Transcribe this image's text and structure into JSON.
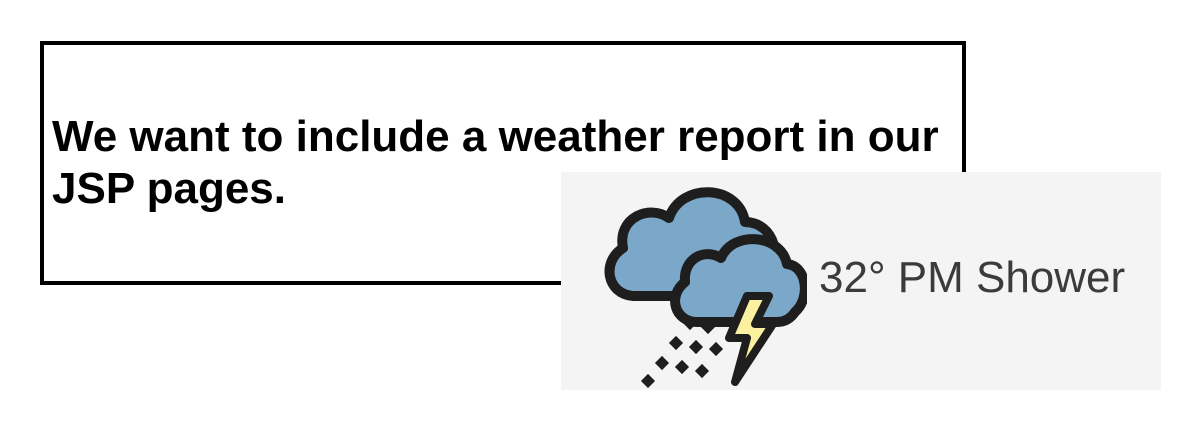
{
  "statement": {
    "text": "We want to include a weather report in our JSP pages."
  },
  "weather": {
    "label": "32° PM Shower",
    "icon": "thunderstorm-rain-icon",
    "colors": {
      "cloud": "#7ba7c9",
      "outline": "#1e1e1e",
      "bolt": "#fbf0a0",
      "background": "#f4f4f4",
      "text": "#3b3b3b"
    }
  }
}
